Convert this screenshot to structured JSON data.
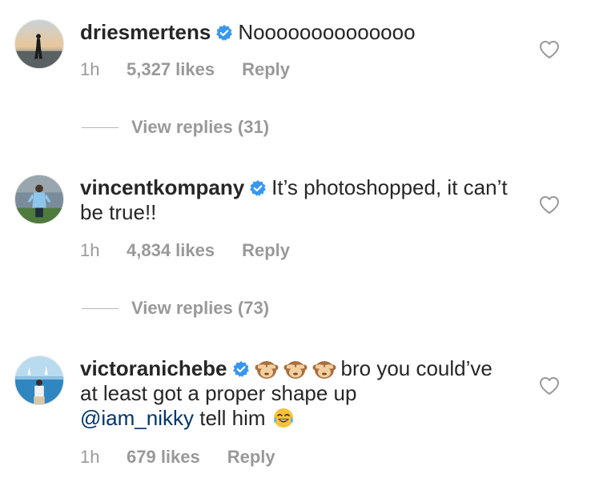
{
  "comments": [
    {
      "username": "driesmertens",
      "verified": true,
      "text": "Noooooooooooooo",
      "time": "1h",
      "likes": "5,327 likes",
      "reply_label": "Reply",
      "view_replies": "View replies (31)"
    },
    {
      "username": "vincentkompany",
      "verified": true,
      "text": "It’s photoshopped, it can’t be true!!",
      "time": "1h",
      "likes": "4,834 likes",
      "reply_label": "Reply",
      "view_replies": "View replies (73)"
    },
    {
      "username": "victoranichebe",
      "verified": true,
      "emoji_prefix": [
        "see-no-evil-monkey",
        "see-no-evil-monkey",
        "see-no-evil-monkey"
      ],
      "text": "bro you could’ve at least got a proper shape up",
      "mention": "@iam_nikky",
      "text_after_mention": "tell him",
      "emoji_suffix": [
        "tears-of-joy"
      ],
      "time": "1h",
      "likes": "679 likes",
      "reply_label": "Reply"
    }
  ],
  "colors": {
    "text": "#262626",
    "meta": "#999999",
    "verified_badge": "#3897f0",
    "mention": "#003569"
  }
}
